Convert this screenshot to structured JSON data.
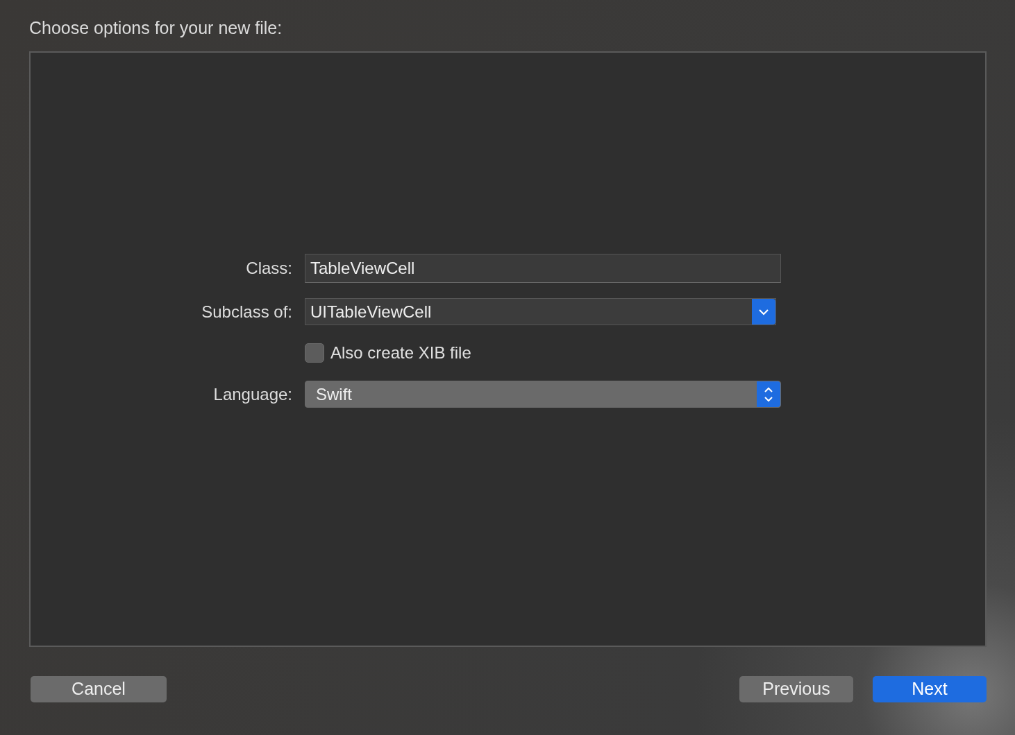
{
  "window": {
    "title": "Choose options for your new file:"
  },
  "fields": [
    {
      "kind": "text",
      "label": "Class:",
      "value": "TableViewCell"
    },
    {
      "kind": "popup",
      "label": "Subclass of:",
      "value": "UITableViewCell"
    },
    {
      "kind": "checkbox",
      "label": "Also create XIB file",
      "checked": false
    },
    {
      "kind": "stepper",
      "label": "Language:",
      "value": "Swift"
    }
  ],
  "buttons": [
    {
      "label": "Cancel",
      "kind": "default"
    },
    {
      "label": "Previous",
      "kind": "default"
    },
    {
      "label": "Next",
      "kind": "primary"
    }
  ]
}
